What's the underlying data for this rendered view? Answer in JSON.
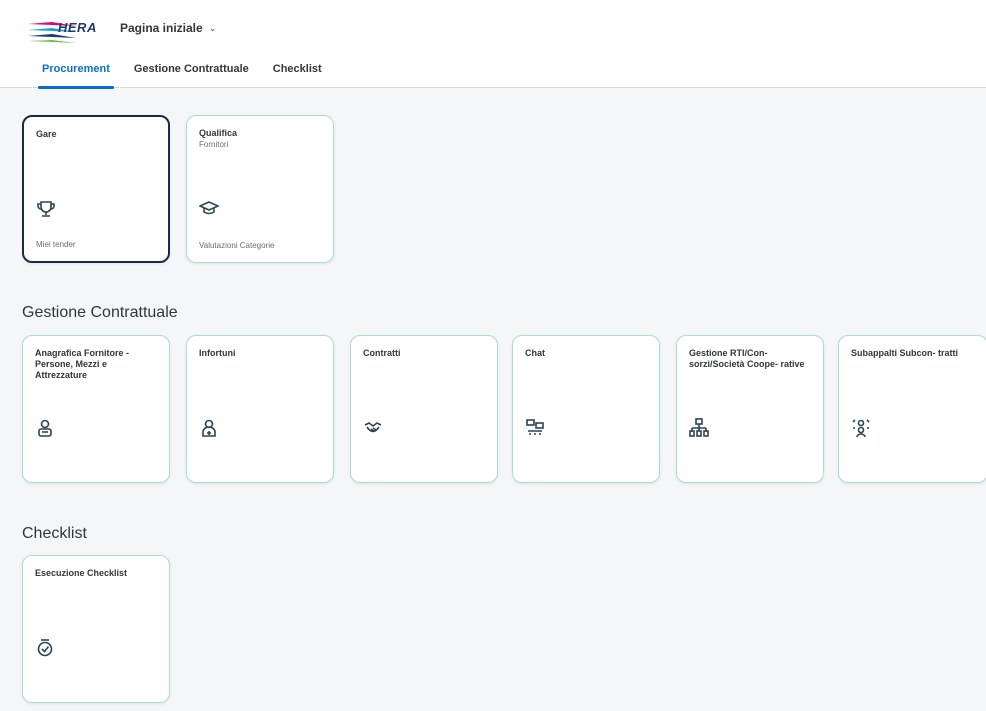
{
  "header": {
    "logo_text": "HERA",
    "home_label": "Pagina iniziale",
    "tabs": [
      {
        "label": "Procurement",
        "active": true
      },
      {
        "label": "Gestione Contrattuale",
        "active": false
      },
      {
        "label": "Checklist",
        "active": false
      }
    ]
  },
  "colors": {
    "accent": "#0a6ed1",
    "tile_border": "#a9dbd8",
    "selected_border": "#1b2a4a",
    "icon": "#2b4456"
  },
  "procurement": {
    "tiles": [
      {
        "title": "Gare",
        "subtitle": "",
        "footer": "Miei tender",
        "icon": "trophy-icon"
      },
      {
        "title": "Qualifica",
        "subtitle": "Fornitori",
        "footer": "Valutazioni Categorie",
        "icon": "graduation-cap-icon"
      }
    ]
  },
  "gestione": {
    "title": "Gestione Contrattuale",
    "tiles": [
      {
        "title": "Anagrafica Fornitore - Persone, Mezzi e Attrezzature",
        "icon": "person-badge-icon"
      },
      {
        "title": "Infortuni",
        "icon": "injured-person-icon"
      },
      {
        "title": "Contratti",
        "icon": "handshake-icon"
      },
      {
        "title": "Chat",
        "icon": "chat-icon"
      },
      {
        "title": "Gestione RTI/Con- sorzi/Società Coope- rative",
        "icon": "org-hierarchy-icon"
      },
      {
        "title": "Subappalti Subcon- tratti",
        "icon": "group-icon"
      }
    ]
  },
  "checklist": {
    "title": "Checklist",
    "tiles": [
      {
        "title": "Esecuzione Checklist",
        "icon": "badge-check-icon"
      }
    ]
  }
}
